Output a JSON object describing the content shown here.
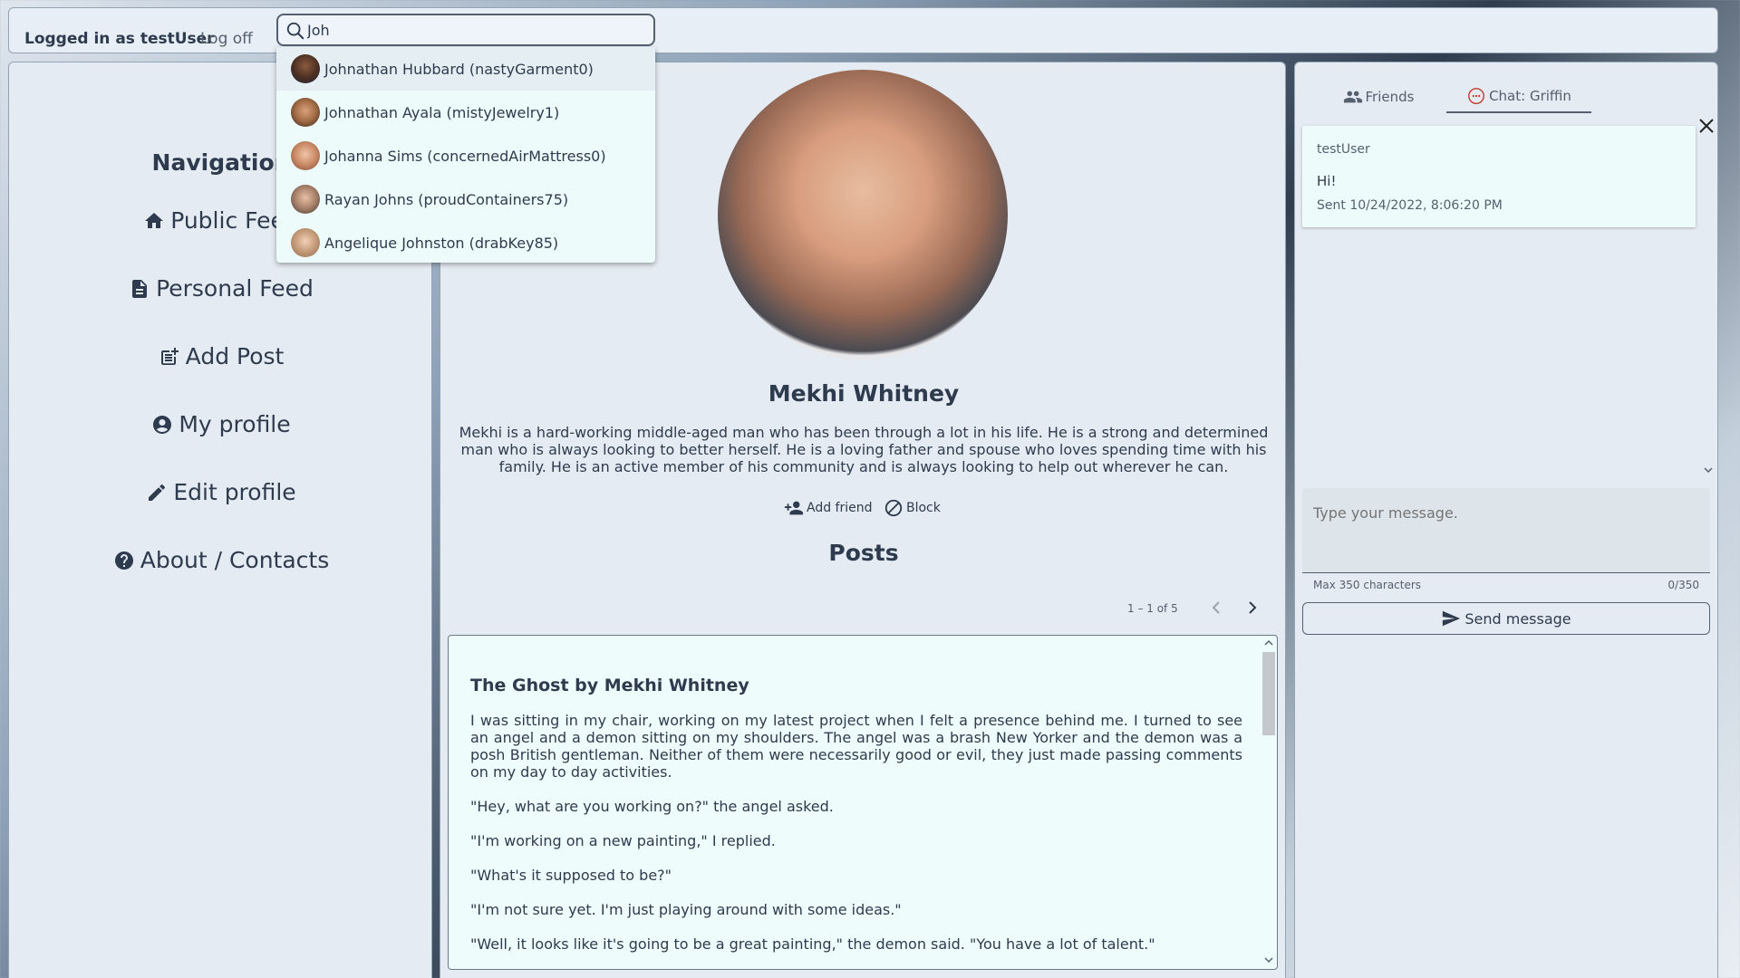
{
  "header": {
    "login_text": "Logged in as testUser",
    "logoff_label": "Log off"
  },
  "search": {
    "value": "Joh",
    "results": [
      {
        "label": "Johnathan Hubbard (nastyGarment0)"
      },
      {
        "label": "Johnathan Ayala (mistyJewelry1)"
      },
      {
        "label": "Johanna Sims (concernedAirMattress0)"
      },
      {
        "label": "Rayan Johns (proudContainers75)"
      },
      {
        "label": "Angelique Johnston (drabKey85)"
      }
    ]
  },
  "nav": {
    "title": "Navigation",
    "items": [
      {
        "label": "Public Feed",
        "icon": "home-icon"
      },
      {
        "label": "Personal Feed",
        "icon": "document-icon"
      },
      {
        "label": "Add Post",
        "icon": "post-add-icon"
      },
      {
        "label": "My profile",
        "icon": "account-circle-icon"
      },
      {
        "label": "Edit profile",
        "icon": "pencil-icon"
      },
      {
        "label": "About / Contacts",
        "icon": "help-circle-icon"
      }
    ]
  },
  "profile": {
    "name": "Mekhi Whitney",
    "bio": "Mekhi is a hard-working middle-aged man who has been through a lot in his life. He is a strong and determined man who is always looking to better herself. He is a loving father and spouse who loves spending time with his family. He is an active member of his community and is always looking to help out wherever he can.",
    "add_friend_label": "Add friend",
    "block_label": "Block"
  },
  "posts": {
    "title": "Posts",
    "pager_text": "1 – 1 of 5",
    "post": {
      "title": "The Ghost by Mekhi Whitney",
      "paragraphs": [
        "I was sitting in my chair, working on my latest project when I felt a presence behind me. I turned to see an angel and a demon sitting on my shoulders. The angel was a brash New Yorker and the demon was a posh British gentleman. Neither of them were necessarily good or evil, they just made passing comments on my day to day activities.",
        "\"Hey, what are you working on?\" the angel asked.",
        "\"I'm working on a new painting,\" I replied.",
        "\"What's it supposed to be?\"",
        "\"I'm not sure yet. I'm just playing around with some ideas.\"",
        "\"Well, it looks like it's going to be a great painting,\" the demon said. \"You have a lot of talent.\""
      ]
    }
  },
  "chat": {
    "tabs": [
      {
        "label": "Friends",
        "icon": "people-icon"
      },
      {
        "label": "Chat: Griffin",
        "icon": "chat-bubble-icon"
      }
    ],
    "message": {
      "user": "testUser",
      "text": "Hi!",
      "time": "Sent 10/24/2022, 8:06:20 PM"
    },
    "input_placeholder": "Type your message.",
    "hint": "Max 350 characters",
    "count": "0/350",
    "send_label": "Send message"
  },
  "colors": {
    "panel_bg": "#e5ebf2",
    "text": "#2e3b4e",
    "dropdown_bg": "#eefbfb"
  }
}
